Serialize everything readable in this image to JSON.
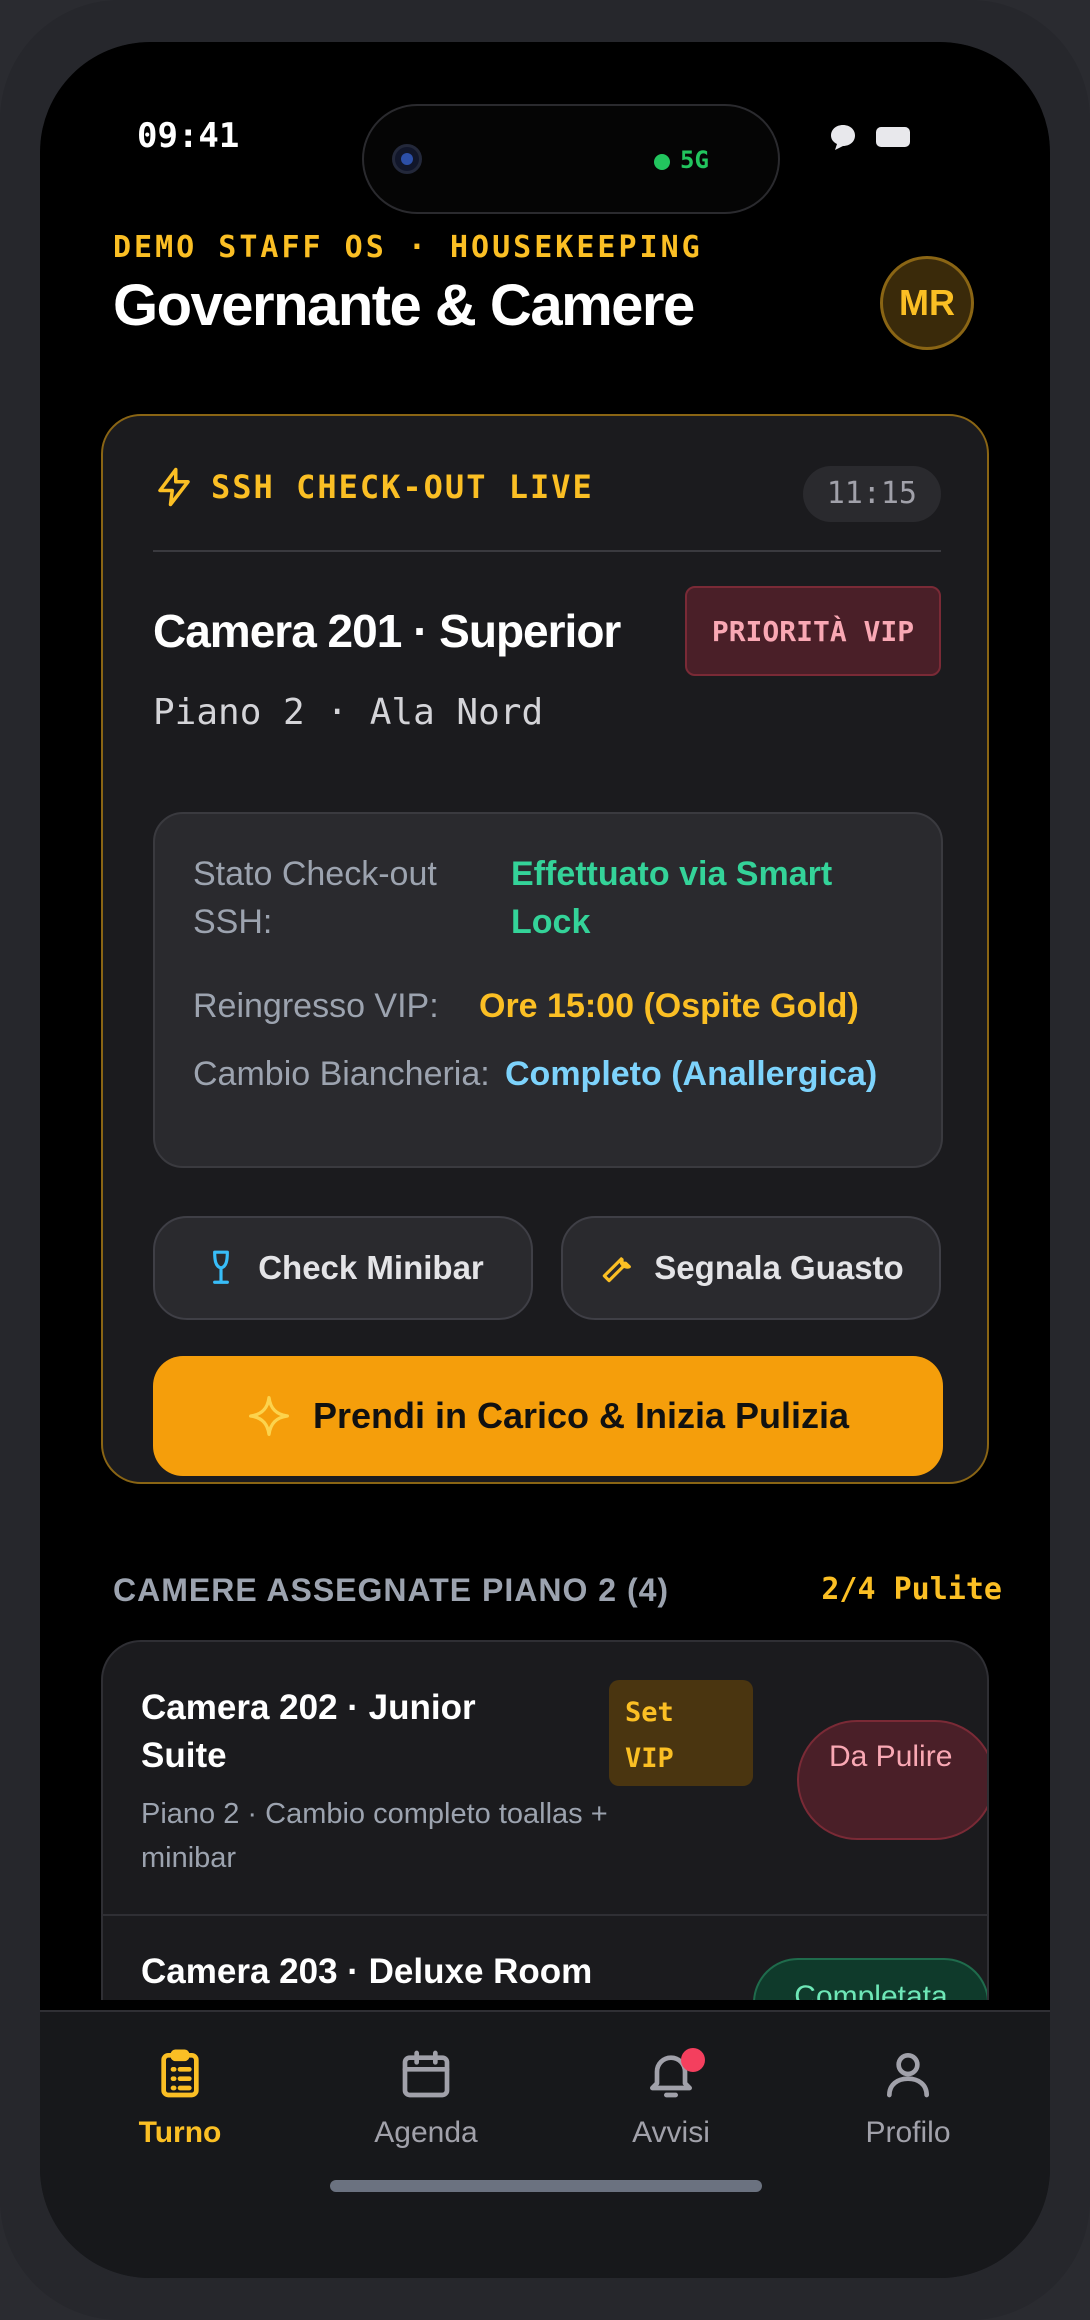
{
  "status_bar": {
    "time": "09:41",
    "network": "5G"
  },
  "header": {
    "eyebrow": "DEMO STAFF OS · HOUSEKEEPING",
    "title": "Governante & Camere",
    "avatar_initials": "MR"
  },
  "live_card": {
    "label": "SSH CHECK-OUT LIVE",
    "time": "11:15",
    "room_title": "Camera 201 · Superior",
    "priority_badge": "PRIORITÀ VIP",
    "location": "Piano 2 · Ala Nord",
    "details": [
      {
        "label": "Stato Check-out SSH:",
        "value": "Effettuato via Smart Lock"
      },
      {
        "label": "Reingresso VIP:",
        "value": "Ore 15:00 (Ospite Gold)"
      },
      {
        "label": "Cambio Biancheria:",
        "value": "Completo (Anallergica)"
      }
    ],
    "actions": {
      "minibar": "Check Minibar",
      "fault": "Segnala Guasto"
    },
    "primary_action": "Prendi in Carico & Inizia Pulizia"
  },
  "assigned": {
    "title": "CAMERE ASSEGNATE PIANO 2 (4)",
    "progress": "2/4 Pulite",
    "rooms": [
      {
        "title": "Camera 202 · Junior Suite",
        "subtitle": "Piano 2 · Cambio completo toallas + minibar",
        "tag": "Set VIP",
        "status": "Da Pulire"
      },
      {
        "title": "Camera 203 · Deluxe Room",
        "status": "Completata"
      }
    ]
  },
  "tabs": [
    {
      "label": "Turno"
    },
    {
      "label": "Agenda"
    },
    {
      "label": "Avvisi"
    },
    {
      "label": "Profilo"
    }
  ],
  "colors": {
    "accent": "#f59e0b",
    "accent_text": "#fbbf24",
    "success": "#34d399",
    "info": "#7dd3fc",
    "danger": "#f9a8b4"
  }
}
